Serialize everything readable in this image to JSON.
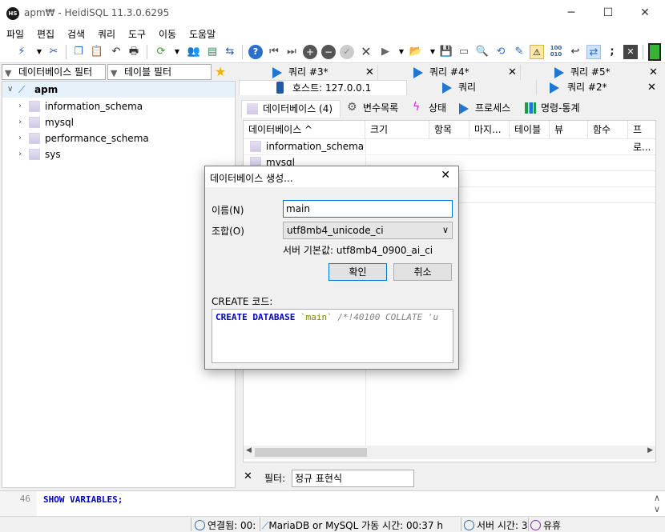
{
  "window": {
    "title": "apm₩ - HeidiSQL 11.3.0.6295",
    "app_icon_text": "HS",
    "minimize_glyph": "─",
    "maximize_glyph": "☐",
    "close_glyph": "✕"
  },
  "menu": [
    "파일",
    "편집",
    "검색",
    "쿼리",
    "도구",
    "이동",
    "도움말"
  ],
  "toolbar": {
    "icons": [
      "plug-icon",
      "disconnect-icon",
      "copy-icon",
      "paste-icon",
      "undo-icon",
      "print-icon",
      "refresh-icon",
      "user-manager-icon",
      "export-icon",
      "arrows-icon",
      "help-icon",
      "first-icon",
      "last-icon",
      "add-icon",
      "delete-icon",
      "check-icon",
      "cancel-icon",
      "run-icon",
      "open-folder-icon",
      "save-icon",
      "query-log-icon",
      "search-icon",
      "find-replace-icon",
      "clear-icon",
      "warning-icon",
      "binary-icon",
      "wrap-icon",
      "sync-icon",
      "semicolon-icon",
      "close-tab-icon",
      "green-box-icon"
    ]
  },
  "left_pane": {
    "db_filter_label": "데이터베이스 필터",
    "table_filter_label": "테이블 필터",
    "tree": {
      "root": "apm",
      "items": [
        "information_schema",
        "mysql",
        "performance_schema",
        "sys"
      ]
    }
  },
  "tabs": {
    "query_tabs": [
      {
        "label": "쿼리 #3*",
        "closable": true
      },
      {
        "label": "쿼리 #4*",
        "closable": true
      },
      {
        "label": "쿼리 #5*",
        "closable": true
      }
    ],
    "host_tab": "호스트: 127.0.0.1",
    "second_row": [
      {
        "label": "쿼리",
        "closable": false
      },
      {
        "label": "쿼리 #2*",
        "closable": true
      }
    ],
    "sub_tabs": [
      "데이터베이스 (4)",
      "변수목록",
      "상태",
      "프로세스",
      "명령-통계"
    ]
  },
  "grid": {
    "columns": [
      "데이터베이스 ^",
      "크기",
      "항목",
      "마지...",
      "테이블",
      "뷰",
      "함수",
      "프로..."
    ],
    "rows": [
      "information_schema",
      "mysql",
      "",
      ""
    ]
  },
  "filter_row": {
    "close_glyph": "✕",
    "label": "필터:",
    "placeholder": "정규 표현식"
  },
  "sql_log": {
    "line_number": "46",
    "text": "SHOW VARIABLES;"
  },
  "status_bar": {
    "connected": "연결됨: 00:",
    "server_type": "MariaDB or MySQL 가동 시간: 00:37 h",
    "server_time": "서버 시간: 3",
    "idle": "유휴"
  },
  "dialog": {
    "title": "데이터베이스 생성...",
    "name_label": "이름(N)",
    "name_value": "main",
    "collation_label": "조합(O)",
    "collation_value": "utf8mb4_unicode_ci",
    "server_default": "서버 기본값: utf8mb4_0900_ai_ci",
    "ok_label": "확인",
    "cancel_label": "취소",
    "create_code_label": "CREATE 코드:",
    "create_code": {
      "keyword": "CREATE DATABASE",
      "name": "`main`",
      "comment": "/*!40100 COLLATE 'u"
    }
  }
}
